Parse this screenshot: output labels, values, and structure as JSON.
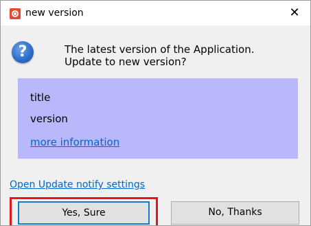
{
  "window": {
    "title": "new version",
    "close_label": "✕"
  },
  "message": {
    "line1": "The latest version of the Application.",
    "line2": "Update to new version?"
  },
  "info": {
    "title": "title",
    "version": "version",
    "more_link": "more information"
  },
  "settings_link": "Open Update notify settings",
  "buttons": {
    "yes": "Yes, Sure",
    "no": "No, Thanks"
  },
  "colors": {
    "panel": "#b8b8fa",
    "link": "#0066cc",
    "highlight": "#e8131c",
    "focus_border": "#1877d2"
  },
  "icons": {
    "app": "app-logo-icon",
    "question": "question-icon",
    "close": "close-icon"
  }
}
